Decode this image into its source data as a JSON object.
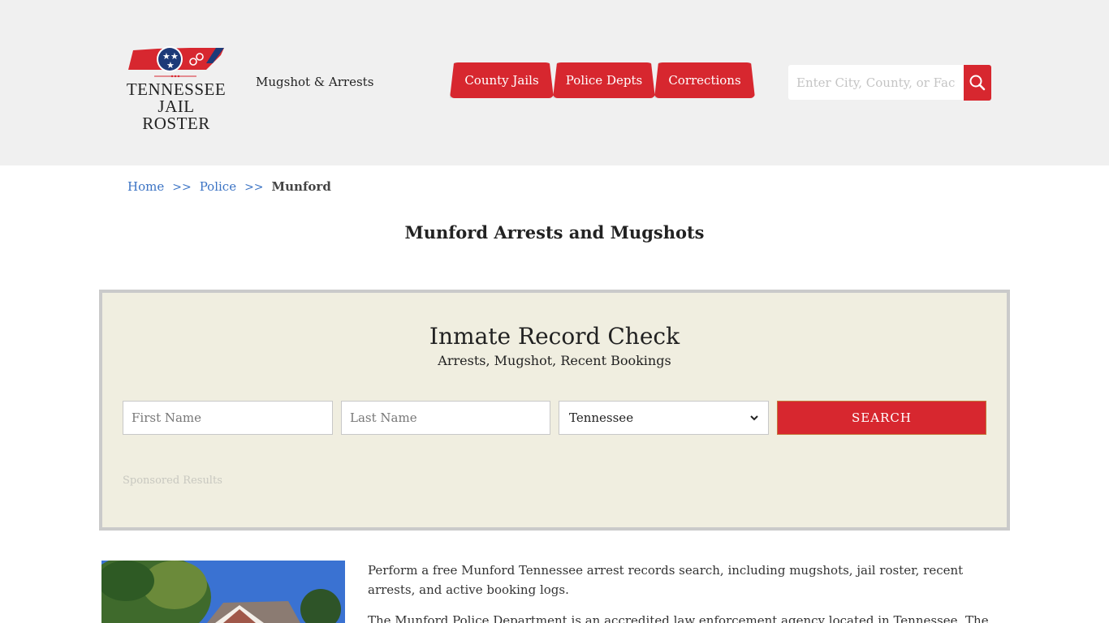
{
  "header": {
    "logo": {
      "line1": "TENNESSEE",
      "line2": "JAIL ROSTER",
      "icon": "tennessee-state-flag-handcuffs-icon"
    },
    "tagline": "Mugshot & Arrests",
    "nav": [
      {
        "label": "County Jails"
      },
      {
        "label": "Police Depts"
      },
      {
        "label": "Corrections"
      }
    ],
    "search": {
      "placeholder": "Enter City, County, or Facility",
      "value": "",
      "icon": "search-icon"
    }
  },
  "breadcrumb": {
    "items": [
      {
        "label": "Home"
      },
      {
        "label": "Police"
      }
    ],
    "separator": ">>",
    "current": "Munford"
  },
  "page_title": "Munford Arrests and Mugshots",
  "record_check": {
    "title": "Inmate Record Check",
    "subtitle": "Arrests, Mugshot, Recent Bookings",
    "first_name": {
      "placeholder": "First Name",
      "value": ""
    },
    "last_name": {
      "placeholder": "Last Name",
      "value": ""
    },
    "state_select": {
      "value": "Tennessee"
    },
    "submit_label": "SEARCH",
    "sponsored_label": "Sponsored Results"
  },
  "content": {
    "image_alt": "Munford Police Department building",
    "paragraphs": [
      "Perform a free Munford Tennessee arrest records search, including mugshots, jail roster, recent arrests, and active booking logs.",
      "The Munford Police Department is an accredited law enforcement agency located in Tennessee. The"
    ]
  },
  "colors": {
    "accent": "#d7272f",
    "header_bg": "#f0f0f0",
    "panel_bg": "#f0eee0",
    "link": "#3b73c4"
  }
}
